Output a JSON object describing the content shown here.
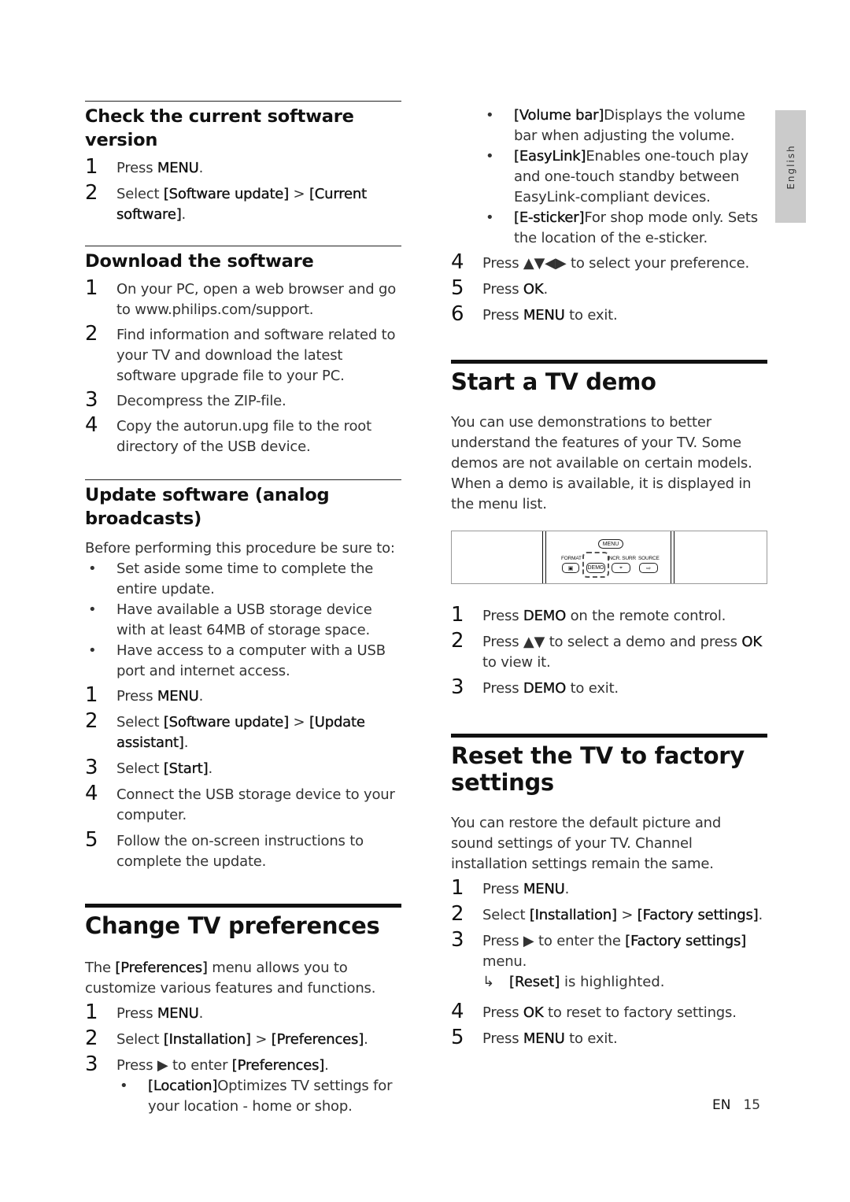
{
  "left_column": {
    "check_version": {
      "heading": "Check the current software version",
      "steps": [
        {
          "num": "1",
          "pre": "Press ",
          "b1": "MENU",
          "post": "."
        },
        {
          "num": "2",
          "pre": "Select ",
          "b1": "[Software update]",
          "mid": " > ",
          "b2": "[Current software]",
          "post": "."
        }
      ]
    },
    "download": {
      "heading": "Download the software",
      "steps": [
        {
          "num": "1",
          "text": "On your PC, open a web browser and go to www.philips.com/support."
        },
        {
          "num": "2",
          "text": "Find information and software related to your TV and download the latest software upgrade file to your PC."
        },
        {
          "num": "3",
          "text": "Decompress the ZIP-file."
        },
        {
          "num": "4",
          "text": "Copy the autorun.upg file to the root directory of the USB device."
        }
      ]
    },
    "update_analog": {
      "heading": "Update software (analog broadcasts)",
      "intro": "Before performing this procedure be sure to:",
      "bullets": [
        "Set aside some time to complete the entire update.",
        "Have available a USB storage device with at least 64MB of storage space.",
        "Have access to a computer with a USB port and internet access."
      ],
      "steps": [
        {
          "num": "1",
          "pre": "Press ",
          "b1": "MENU",
          "post": "."
        },
        {
          "num": "2",
          "pre": "Select ",
          "b1": "[Software update]",
          "mid": " > ",
          "b2": "[Update assistant]",
          "post": "."
        },
        {
          "num": "3",
          "pre": "Select ",
          "b1": "[Start]",
          "post": "."
        },
        {
          "num": "4",
          "text": "Connect the USB storage device to your computer."
        },
        {
          "num": "5",
          "text": "Follow the on-screen instructions to complete the update."
        }
      ]
    },
    "preferences": {
      "heading": "Change TV preferences",
      "intro_pre": "The ",
      "intro_b": "[Preferences]",
      "intro_post": " menu allows you to customize various features and functions.",
      "steps": [
        {
          "num": "1",
          "pre": "Press ",
          "b1": "MENU",
          "post": "."
        },
        {
          "num": "2",
          "pre": "Select ",
          "b1": "[Installation]",
          "mid": " > ",
          "b2": "[Preferences]",
          "post": "."
        },
        {
          "num": "3",
          "pre": "Press ▶ to enter ",
          "b1": "[Preferences]",
          "post": "."
        }
      ],
      "sub_bullets": [
        {
          "b": "[Location]",
          "text": "Optimizes TV settings for your location - home or shop."
        }
      ]
    }
  },
  "right_column": {
    "preferences_cont": {
      "sub_bullets": [
        {
          "b": "[Volume bar]",
          "text": "Displays the volume bar when adjusting the volume."
        },
        {
          "b": "[EasyLink]",
          "text": "Enables one-touch play and one-touch standby between EasyLink-compliant devices."
        },
        {
          "b": "[E-sticker]",
          "text": "For shop mode only. Sets the location of the e-sticker."
        }
      ],
      "steps": [
        {
          "num": "4",
          "pre": "Press ▲▼◀▶ to select your preference.",
          "b1": "",
          "post": ""
        },
        {
          "num": "5",
          "pre": "Press ",
          "b1": "OK",
          "post": "."
        },
        {
          "num": "6",
          "pre": "Press ",
          "b1": "MENU",
          "post": " to exit."
        }
      ]
    },
    "demo": {
      "heading": "Start a TV demo",
      "intro": "You can use demonstrations to better understand the features of your TV. Some demos are not available on certain models. When a demo is available, it is displayed in the menu list.",
      "remote": {
        "menu": "MENU",
        "format": "FORMAT",
        "demo": "DEMO",
        "incr_surr": "INCR. SURR",
        "source": "SOURCE"
      },
      "steps": [
        {
          "num": "1",
          "pre": "Press ",
          "b1": "DEMO",
          "post": " on the remote control."
        },
        {
          "num": "2",
          "pre": "Press ▲▼ to select a demo and press ",
          "b1": "OK",
          "post": " to view it."
        },
        {
          "num": "3",
          "pre": "Press ",
          "b1": "DEMO",
          "post": " to exit."
        }
      ]
    },
    "reset": {
      "heading": "Reset the TV to factory settings",
      "intro": "You can restore the default picture and sound settings of your TV. Channel installation settings remain the same.",
      "steps": [
        {
          "num": "1",
          "pre": "Press ",
          "b1": "MENU",
          "post": "."
        },
        {
          "num": "2",
          "pre": "Select ",
          "b1": "[Installation]",
          "mid": " > ",
          "b2": "[Factory settings]",
          "post": "."
        },
        {
          "num": "3",
          "pre": "Press ▶ to enter the ",
          "b1": "[Factory settings]",
          "post": " menu."
        }
      ],
      "result": {
        "arrow": "↳",
        "b": "[Reset]",
        "text": " is highlighted."
      },
      "steps_after": [
        {
          "num": "4",
          "pre": "Press ",
          "b1": "OK",
          "post": " to reset to factory settings."
        },
        {
          "num": "5",
          "pre": "Press ",
          "b1": "MENU",
          "post": " to exit."
        }
      ]
    }
  },
  "side_tab": {
    "label": "English"
  },
  "footer": {
    "lang": "EN",
    "page": "15"
  }
}
